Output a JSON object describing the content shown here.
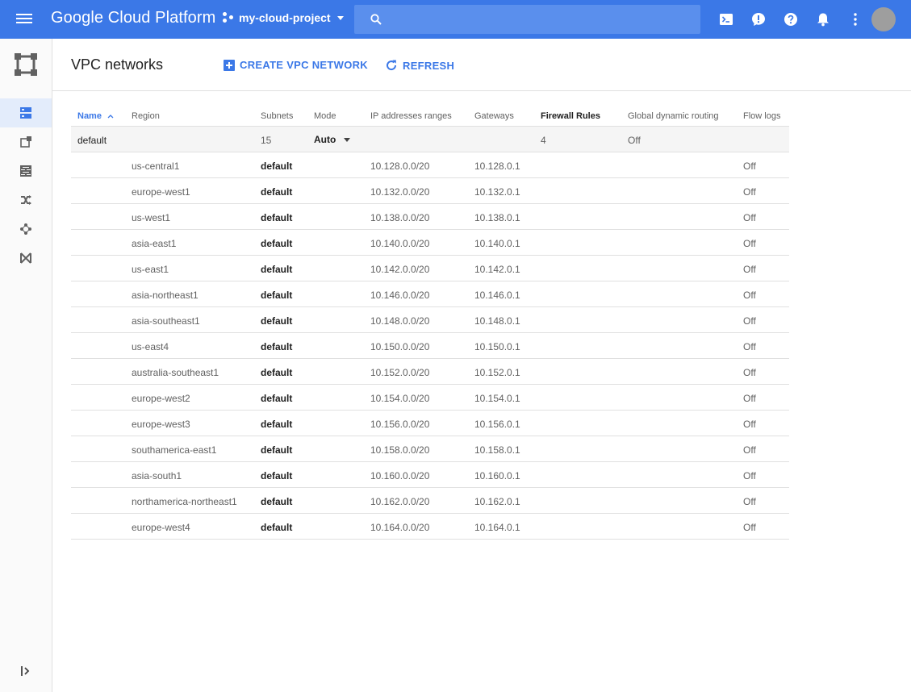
{
  "header": {
    "brand": "Google Cloud Platform",
    "project": "my-cloud-project",
    "search_placeholder": "",
    "icons": [
      "menu-icon",
      "project-icon",
      "search-icon",
      "cloud-shell-icon",
      "feedback-icon",
      "help-icon",
      "notifications-icon",
      "more-vert-icon",
      "avatar"
    ],
    "accent_color": "#3b78e7"
  },
  "sidebar": {
    "items": [
      {
        "icon": "vpc-networks-icon",
        "active": true
      },
      {
        "icon": "external-ip-icon",
        "active": false
      },
      {
        "icon": "firewall-rules-icon",
        "active": false
      },
      {
        "icon": "routes-icon",
        "active": false
      },
      {
        "icon": "vpc-peering-icon",
        "active": false
      },
      {
        "icon": "shared-vpc-icon",
        "active": false
      }
    ]
  },
  "page": {
    "title": "VPC networks",
    "create_label": "CREATE VPC NETWORK",
    "refresh_label": "REFRESH"
  },
  "table": {
    "columns": [
      "Name",
      "Region",
      "Subnets",
      "Mode",
      "IP addresses ranges",
      "Gateways",
      "Firewall Rules",
      "Global dynamic routing",
      "Flow logs"
    ],
    "network": {
      "name": "default",
      "subnets": "15",
      "mode": "Auto",
      "firewall_rules": "4",
      "global_dynamic_routing": "Off"
    },
    "subnets": [
      {
        "region": "us-central1",
        "name": "default",
        "range": "10.128.0.0/20",
        "gateway": "10.128.0.1",
        "flow_logs": "Off"
      },
      {
        "region": "europe-west1",
        "name": "default",
        "range": "10.132.0.0/20",
        "gateway": "10.132.0.1",
        "flow_logs": "Off"
      },
      {
        "region": "us-west1",
        "name": "default",
        "range": "10.138.0.0/20",
        "gateway": "10.138.0.1",
        "flow_logs": "Off"
      },
      {
        "region": "asia-east1",
        "name": "default",
        "range": "10.140.0.0/20",
        "gateway": "10.140.0.1",
        "flow_logs": "Off"
      },
      {
        "region": "us-east1",
        "name": "default",
        "range": "10.142.0.0/20",
        "gateway": "10.142.0.1",
        "flow_logs": "Off"
      },
      {
        "region": "asia-northeast1",
        "name": "default",
        "range": "10.146.0.0/20",
        "gateway": "10.146.0.1",
        "flow_logs": "Off"
      },
      {
        "region": "asia-southeast1",
        "name": "default",
        "range": "10.148.0.0/20",
        "gateway": "10.148.0.1",
        "flow_logs": "Off"
      },
      {
        "region": "us-east4",
        "name": "default",
        "range": "10.150.0.0/20",
        "gateway": "10.150.0.1",
        "flow_logs": "Off"
      },
      {
        "region": "australia-southeast1",
        "name": "default",
        "range": "10.152.0.0/20",
        "gateway": "10.152.0.1",
        "flow_logs": "Off"
      },
      {
        "region": "europe-west2",
        "name": "default",
        "range": "10.154.0.0/20",
        "gateway": "10.154.0.1",
        "flow_logs": "Off"
      },
      {
        "region": "europe-west3",
        "name": "default",
        "range": "10.156.0.0/20",
        "gateway": "10.156.0.1",
        "flow_logs": "Off"
      },
      {
        "region": "southamerica-east1",
        "name": "default",
        "range": "10.158.0.0/20",
        "gateway": "10.158.0.1",
        "flow_logs": "Off"
      },
      {
        "region": "asia-south1",
        "name": "default",
        "range": "10.160.0.0/20",
        "gateway": "10.160.0.1",
        "flow_logs": "Off"
      },
      {
        "region": "northamerica-northeast1",
        "name": "default",
        "range": "10.162.0.0/20",
        "gateway": "10.162.0.1",
        "flow_logs": "Off"
      },
      {
        "region": "europe-west4",
        "name": "default",
        "range": "10.164.0.0/20",
        "gateway": "10.164.0.1",
        "flow_logs": "Off"
      }
    ]
  }
}
